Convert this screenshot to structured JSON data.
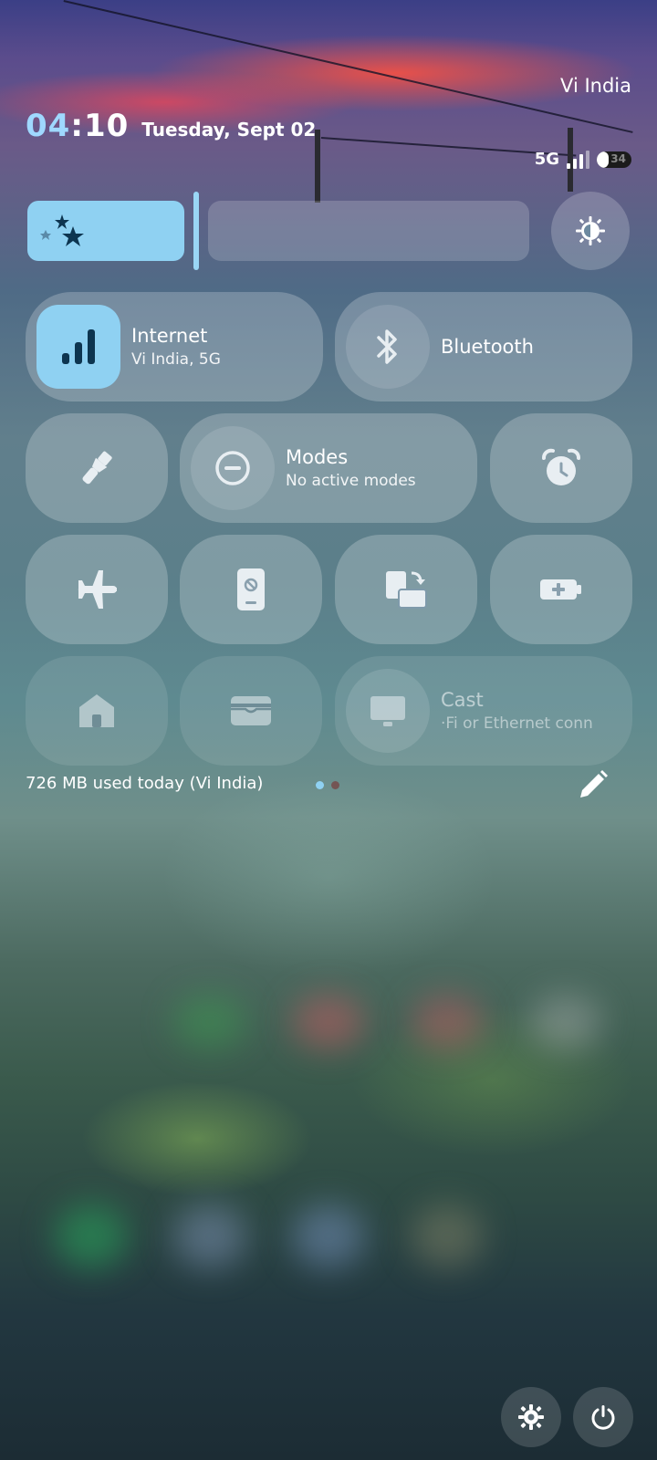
{
  "status": {
    "carrier": "Vi India",
    "time_hour": "04",
    "time_minute": "10",
    "date": "Tuesday, Sept 02",
    "network": "5G",
    "battery_percent": "34"
  },
  "tiles": {
    "internet": {
      "title": "Internet",
      "subtitle": "Vi India, 5G"
    },
    "bluetooth": {
      "title": "Bluetooth"
    },
    "modes": {
      "title": "Modes",
      "subtitle": "No active modes"
    },
    "cast": {
      "title": "Cast",
      "subtitle": "·Fi or Ethernet conn"
    }
  },
  "footer": {
    "data_usage": "726 MB used today (Vi India)",
    "page_count": 2,
    "active_page": 1
  },
  "colors": {
    "accent": "#8fd1f2",
    "time_hour_color": "#9fd8ff"
  },
  "icons": [
    "stars-icon",
    "brightness-icon",
    "signal-bars-icon",
    "bluetooth-icon",
    "flashlight-icon",
    "do-not-disturb-icon",
    "alarm-icon",
    "airplane-icon",
    "phone-rotate-lock-icon",
    "screen-rotate-icon",
    "battery-saver-icon",
    "home-icon",
    "wallet-icon",
    "cast-icon",
    "edit-pencil-icon",
    "settings-icon",
    "power-icon"
  ]
}
